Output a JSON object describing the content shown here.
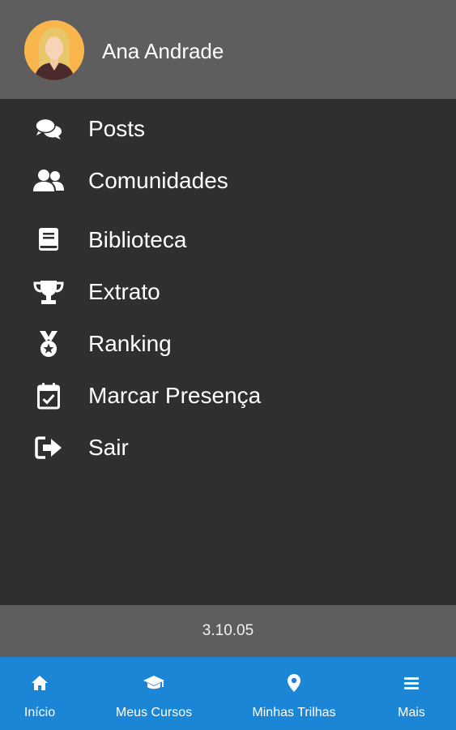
{
  "profile": {
    "name": "Ana Andrade",
    "avatar_icon": "user-avatar-female"
  },
  "menu": {
    "items": [
      {
        "label": "Posts",
        "icon": "comments-icon"
      },
      {
        "label": "Comunidades",
        "icon": "users-icon"
      },
      {
        "label": "Biblioteca",
        "icon": "book-icon"
      },
      {
        "label": "Extrato",
        "icon": "trophy-icon"
      },
      {
        "label": "Ranking",
        "icon": "medal-icon"
      },
      {
        "label": "Marcar Presença",
        "icon": "calendar-check-icon"
      },
      {
        "label": "Sair",
        "icon": "sign-out-icon"
      }
    ]
  },
  "footer": {
    "version": "3.10.05"
  },
  "bottom_nav": {
    "items": [
      {
        "label": "Início",
        "icon": "home-icon"
      },
      {
        "label": "Meus Cursos",
        "icon": "graduation-cap-icon"
      },
      {
        "label": "Minhas Trilhas",
        "icon": "map-marker-icon"
      },
      {
        "label": "Mais",
        "icon": "menu-bars-icon"
      }
    ]
  },
  "colors": {
    "header_bg": "#5e5e5e",
    "menu_bg": "#2f2f2f",
    "bottom_nav_bg": "#1b86d5",
    "text": "#ffffff",
    "avatar_bg": "#f8b64c"
  }
}
